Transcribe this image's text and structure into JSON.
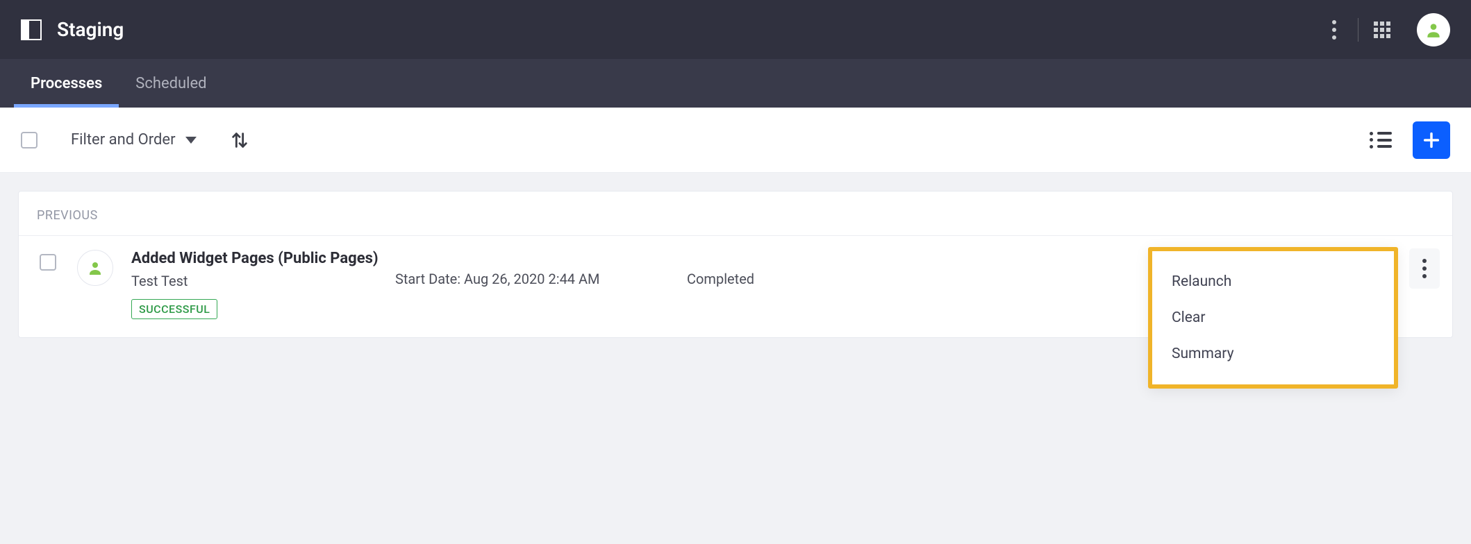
{
  "header": {
    "title": "Staging"
  },
  "tabs": {
    "processes": "Processes",
    "scheduled": "Scheduled",
    "active": "processes"
  },
  "toolbar": {
    "filter_label": "Filter and Order"
  },
  "section": {
    "label": "PREVIOUS"
  },
  "row": {
    "title": "Added Widget Pages (Public Pages)",
    "subtitle": "Test Test",
    "badge": "SUCCESSFUL",
    "start_date": "Start Date: Aug 26, 2020 2:44 AM",
    "status": "Completed"
  },
  "menu": {
    "relaunch": "Relaunch",
    "clear": "Clear",
    "summary": "Summary"
  }
}
